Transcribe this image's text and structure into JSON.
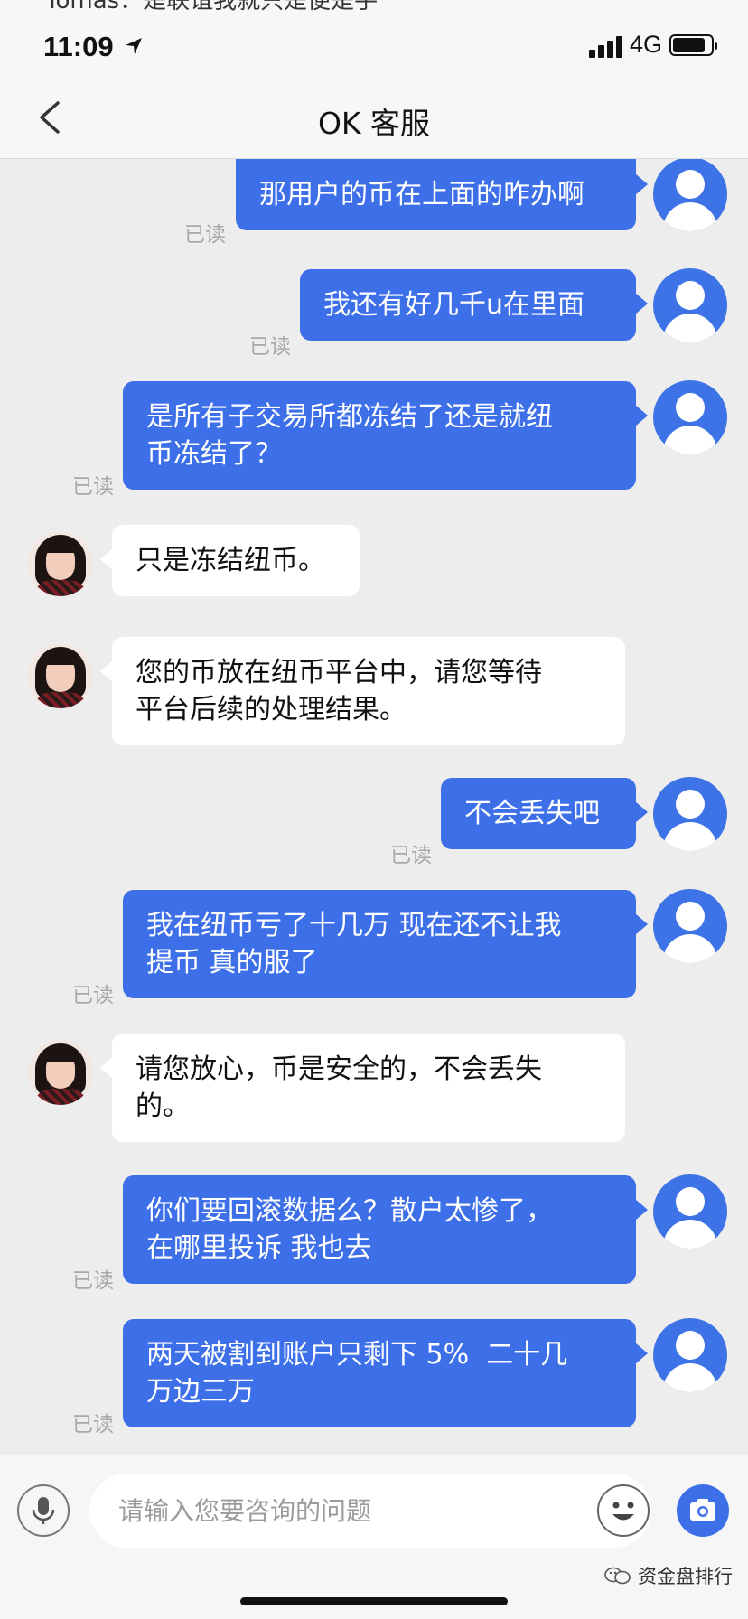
{
  "top_banner": {
    "text": "Tomas：是联谊我就只是便是手"
  },
  "status_bar": {
    "time": "11:09",
    "network": "4G",
    "battery_level": 0.85
  },
  "nav": {
    "title": "OK 客服"
  },
  "messages": [
    {
      "side": "out",
      "text": "那用户的币在上面的咋办啊",
      "read": "已读"
    },
    {
      "side": "out",
      "text": "我还有好几千u在里面",
      "read": "已读"
    },
    {
      "side": "out",
      "text": "是所有子交易所都冻结了还是就纽\n币冻结了？",
      "read": "已读"
    },
    {
      "side": "in",
      "text": "只是冻结纽币。"
    },
    {
      "side": "in",
      "text": "您的币放在纽币平台中，请您等待\n平台后续的处理结果。"
    },
    {
      "side": "out",
      "text": "不会丢失吧",
      "read": "已读"
    },
    {
      "side": "out",
      "text": "我在纽币亏了十几万 现在还不让我\n提币 真的服了",
      "read": "已读"
    },
    {
      "side": "in",
      "text": "请您放心，币是安全的，不会丢失\n的。"
    },
    {
      "side": "out",
      "text": "你们要回滚数据么？散户太惨了，\n在哪里投诉 我也去",
      "read": "已读"
    },
    {
      "side": "out",
      "text": "两天被割到账户只剩下 5%  二十几\n万边三万",
      "read": "已读"
    }
  ],
  "input_bar": {
    "placeholder": "请输入您要咨询的问题"
  },
  "watermark": {
    "text": "资金盘排行"
  },
  "icons": {
    "back": "chevron-left-icon",
    "location": "location-arrow-icon",
    "mic": "microphone-icon",
    "emoji": "smiley-icon",
    "camera": "camera-icon"
  },
  "colors": {
    "accent": "#3c6fe8",
    "background": "#ededed",
    "incoming_bubble": "#ffffff"
  }
}
